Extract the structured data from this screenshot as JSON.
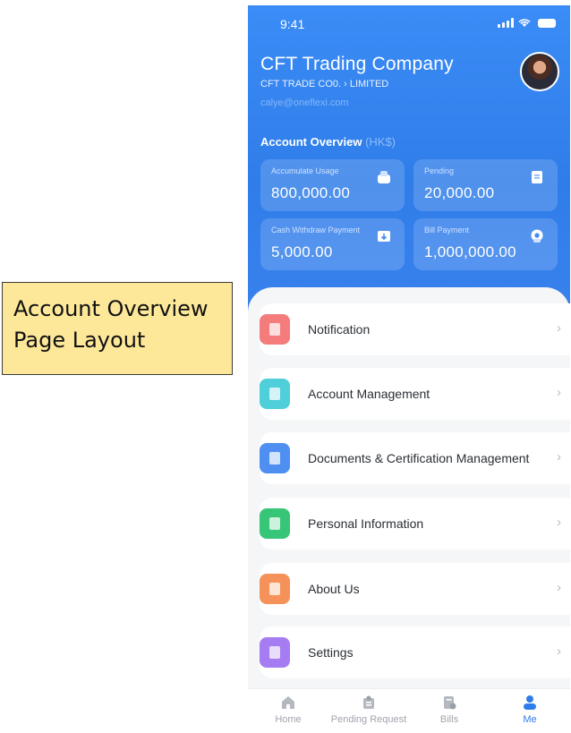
{
  "callout": {
    "line1": "Account Overview",
    "line2": "Page Layout"
  },
  "status_bar": {
    "time": "9:41"
  },
  "profile": {
    "company": "CFT Trading Company",
    "subtitle": "CFT TRADE CO0. › LIMITED",
    "email": "calye@oneflexi.com"
  },
  "overview": {
    "title": "Account Overview",
    "unit": "(HK$)",
    "cards": [
      {
        "label": "Accumulate Usage",
        "value": "800,000.00",
        "icon": "wallet-icon"
      },
      {
        "label": "Pending",
        "value": "20,000.00",
        "icon": "document-icon"
      },
      {
        "label": "Cash Withdraw Payment",
        "value": "5,000.00",
        "icon": "cash-withdraw-icon"
      },
      {
        "label": "Bill Payment",
        "value": "1,000,000.00",
        "icon": "bill-payment-icon"
      }
    ]
  },
  "menu": [
    {
      "label": "Notification",
      "icon": "notification-icon",
      "color": "#f47c7c"
    },
    {
      "label": "Account Management",
      "icon": "account-icon",
      "color": "#4fcfd9"
    },
    {
      "label": "Documents & Certification Management",
      "icon": "documents-icon",
      "color": "#4f8ff2"
    },
    {
      "label": "Personal Information",
      "icon": "person-icon",
      "color": "#37c677"
    },
    {
      "label": "About Us",
      "icon": "about-icon",
      "color": "#f5925a"
    },
    {
      "label": "Settings",
      "icon": "settings-icon",
      "color": "#a57cf2"
    }
  ],
  "chevron": "›",
  "tabs": [
    {
      "label": "Home",
      "icon": "home-icon"
    },
    {
      "label": "Pending Request",
      "icon": "pending-request-icon"
    },
    {
      "label": "Bills",
      "icon": "bills-icon"
    },
    {
      "label": "Me",
      "icon": "me-icon",
      "active": true
    }
  ],
  "colors": {
    "primary": "#2f7de9",
    "background": "#f5f6f8",
    "callout": "#fde89a"
  }
}
